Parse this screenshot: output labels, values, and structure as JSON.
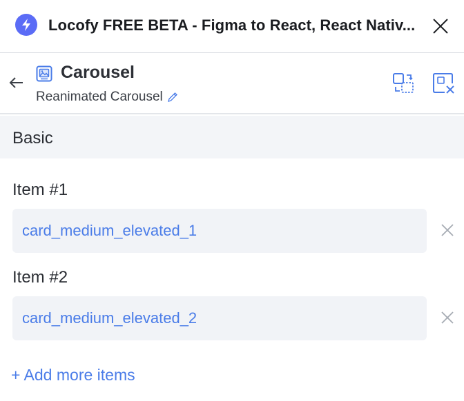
{
  "window": {
    "title": "Locofy FREE BETA - Figma to React, React Nativ...",
    "logo_icon": "bolt-icon",
    "close_icon": "close-icon"
  },
  "header": {
    "back_icon": "arrow-left-icon",
    "component_icon": "image-gallery-icon",
    "title": "Carousel",
    "subtitle": "Reanimated Carousel",
    "edit_icon": "pencil-icon",
    "actions": [
      {
        "icon": "swap-component-icon"
      },
      {
        "icon": "remove-component-icon"
      }
    ]
  },
  "section": {
    "title": "Basic"
  },
  "items": [
    {
      "label": "Item #1",
      "value": "card_medium_elevated_1"
    },
    {
      "label": "Item #2",
      "value": "card_medium_elevated_2"
    }
  ],
  "add_more": {
    "label": "+ Add more items"
  },
  "colors": {
    "accent": "#4a7ce8",
    "logo": "#5b6cf6",
    "field_bg": "#f1f3f7",
    "section_bg": "#f3f5f8"
  }
}
